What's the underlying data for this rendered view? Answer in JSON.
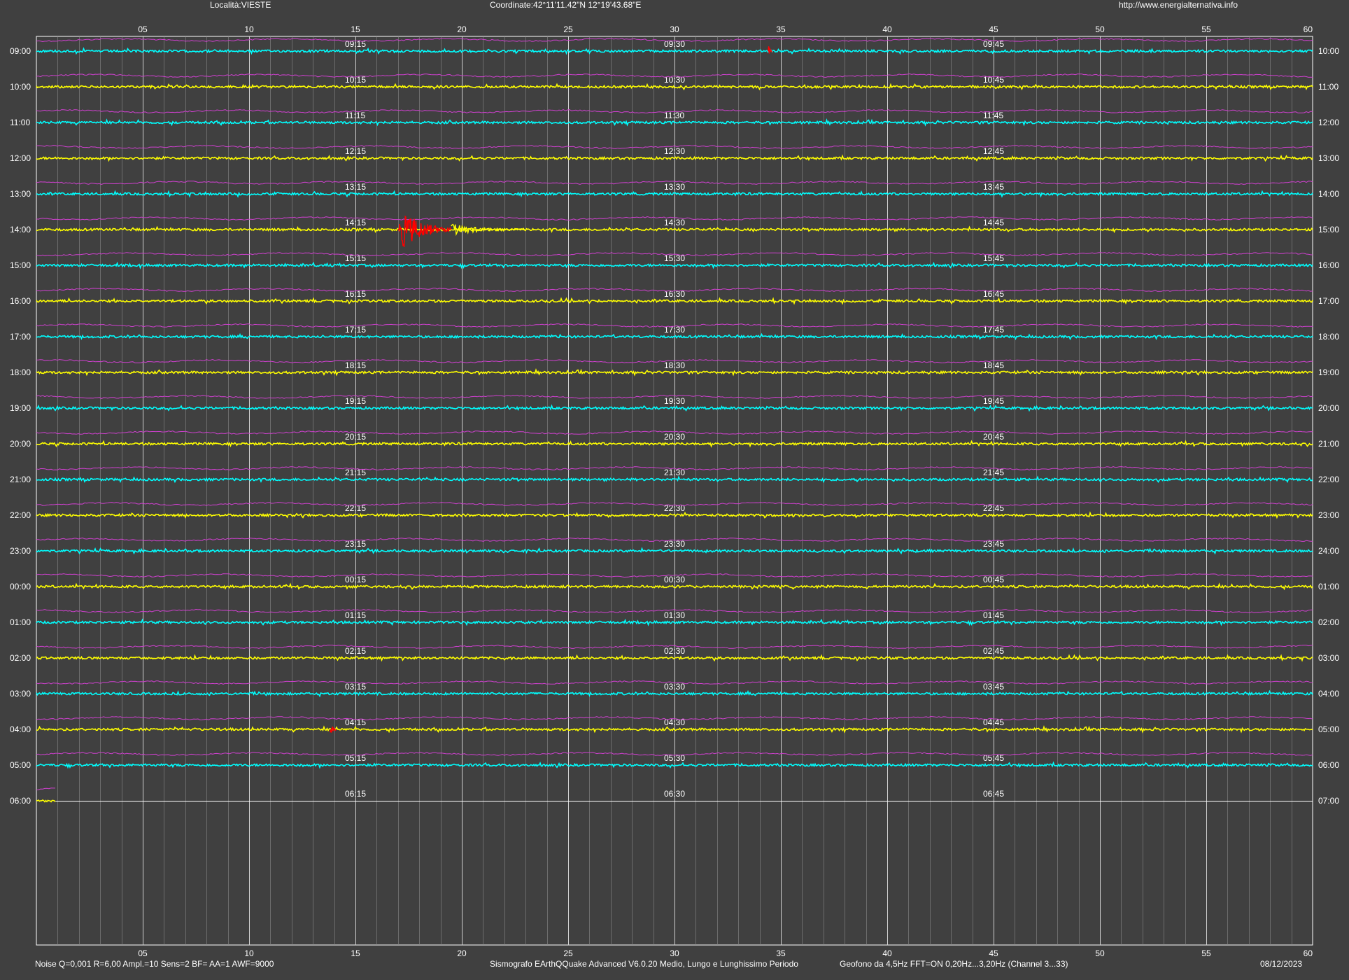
{
  "header": {
    "location": "Località:VIESTE",
    "coordinates": "Coordinate:42°11'11.42\"N  12°19'43.68\"E",
    "url": "http://www.energialternativa.info"
  },
  "footer": {
    "settings": "Noise Q=0,001 R=6,00 Ampl.=10 Sens=2 BF= AA=1 AWF=9000",
    "software": "Sismografo  EArthQQuake Advanced V6.0.20  Medio, Lungo e Lunghissimo Periodo",
    "sensor": "Geofono da 4,5Hz FFT=ON 0,20Hz...3,20Hz      (Channel 3...33)",
    "date": "08/12/2023"
  },
  "colors": {
    "background": "#404040",
    "frame": "#ffffff",
    "grid_major": "#d0d0d0",
    "grid_minor": "#8a8a8a",
    "trace_cyan": "#00ffff",
    "trace_yellow": "#ffff00",
    "filtered_trace": "#d040d0",
    "event": "#ff0000"
  },
  "chart_data": {
    "type": "line",
    "x_unit": "minutes",
    "xlim": [
      0,
      60
    ],
    "x_tick_labels": [
      "05",
      "10",
      "15",
      "20",
      "25",
      "30",
      "35",
      "40",
      "45",
      "50",
      "55",
      "60"
    ],
    "left_hour_labels": [
      "09:00",
      "10:00",
      "11:00",
      "12:00",
      "13:00",
      "14:00",
      "15:00",
      "16:00",
      "17:00",
      "18:00",
      "19:00",
      "20:00",
      "21:00",
      "22:00",
      "23:00",
      "00:00",
      "01:00",
      "02:00",
      "03:00",
      "04:00",
      "05:00",
      "06:00"
    ],
    "right_hour_labels": [
      "10:00",
      "11:00",
      "12:00",
      "13:00",
      "14:00",
      "15:00",
      "16:00",
      "17:00",
      "18:00",
      "19:00",
      "20:00",
      "21:00",
      "22:00",
      "23:00",
      "24:00",
      "01:00",
      "02:00",
      "03:00",
      "04:00",
      "05:00",
      "06:00",
      "07:00"
    ],
    "quarter_markers": [
      {
        "x": 15,
        "labels": [
          "09:15",
          "10:15",
          "11:15",
          "12:15",
          "13:15",
          "14:15",
          "15:15",
          "16:15",
          "17:15",
          "18:15",
          "19:15",
          "20:15",
          "21:15",
          "22:15",
          "23:15",
          "00:15",
          "01:15",
          "02:15",
          "03:15",
          "04:15",
          "05:15",
          "06:15"
        ]
      },
      {
        "x": 30,
        "labels": [
          "09:30",
          "10:30",
          "11:30",
          "12:30",
          "13:30",
          "14:30",
          "15:30",
          "16:30",
          "17:30",
          "18:30",
          "19:30",
          "20:30",
          "21:30",
          "22:30",
          "23:30",
          "00:30",
          "01:30",
          "02:30",
          "03:30",
          "04:30",
          "05:30",
          "06:30"
        ]
      },
      {
        "x": 45,
        "labels": [
          "09:45",
          "10:45",
          "11:45",
          "12:45",
          "13:45",
          "14:45",
          "15:45",
          "16:45",
          "17:45",
          "18:45",
          "19:45",
          "20:45",
          "21:45",
          "22:45",
          "23:45",
          "00:45",
          "01:45",
          "02:45",
          "03:45",
          "04:45",
          "05:45",
          "06:45"
        ]
      }
    ],
    "trace_color_cycle": [
      "cyan",
      "yellow"
    ],
    "last_row_end_minute": 0.9,
    "events": [
      {
        "row": "09:00",
        "start_min": 34.4,
        "end_min": 34.6,
        "peak": 0.3
      },
      {
        "row": "14:00",
        "start_min": 17.0,
        "end_min": 19.5,
        "peak": 1.0
      },
      {
        "row": "04:00",
        "start_min": 13.8,
        "end_min": 14.1,
        "peak": 0.3
      }
    ],
    "aftershock": {
      "row": "14:00",
      "start_min": 19.5,
      "end_min": 23.0,
      "peak": 0.35
    }
  }
}
